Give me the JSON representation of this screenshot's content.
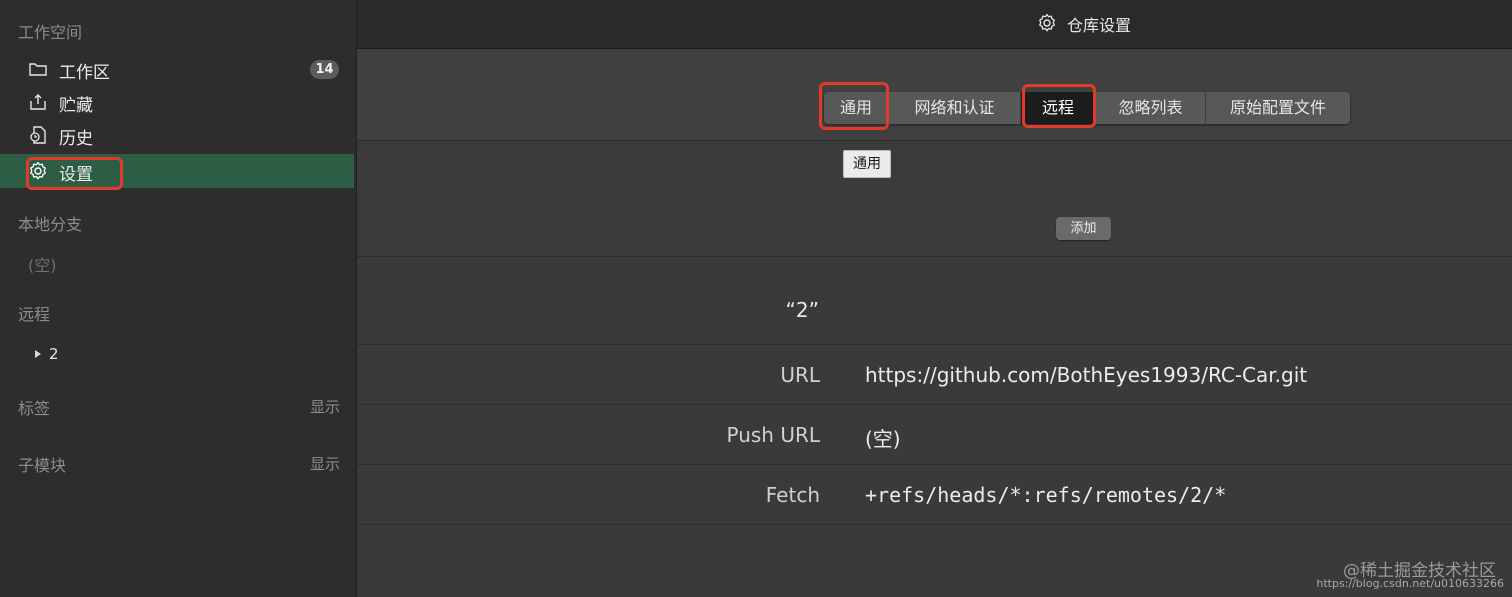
{
  "sidebar": {
    "workspace_title": "工作空间",
    "items": [
      {
        "label": "工作区",
        "badge": "14",
        "icon": "folder-icon"
      },
      {
        "label": "贮藏",
        "icon": "stash-icon"
      },
      {
        "label": "历史",
        "icon": "history-icon"
      },
      {
        "label": "设置",
        "icon": "gear-icon"
      }
    ],
    "local_branches_title": "本地分支",
    "local_branches_empty": "(空)",
    "remotes_title": "远程",
    "remote_item": "2",
    "tags_title": "标签",
    "tags_show": "显示",
    "submodules_title": "子模块",
    "submodules_show": "显示"
  },
  "window": {
    "title": "仓库设置"
  },
  "tabs": [
    "通用",
    "网络和认证",
    "远程",
    "忽略列表",
    "原始配置文件"
  ],
  "selected_tab": "远程",
  "tooltip": "通用",
  "add_button": "添加",
  "remote": {
    "name": "“2”",
    "fields": [
      {
        "key": "URL",
        "value": "https://github.com/BothEyes1993/RC-Car.git"
      },
      {
        "key": "Push URL",
        "value": "(空)"
      },
      {
        "key": "Fetch",
        "value": "+refs/heads/*:refs/remotes/2/*"
      }
    ]
  },
  "watermark": {
    "line1": "@稀土掘金技术社区",
    "line2": "https://blog.csdn.net/u010633266"
  },
  "colors": {
    "active_item_bg": "#2e5d45",
    "highlight_box": "#e03a2a"
  }
}
